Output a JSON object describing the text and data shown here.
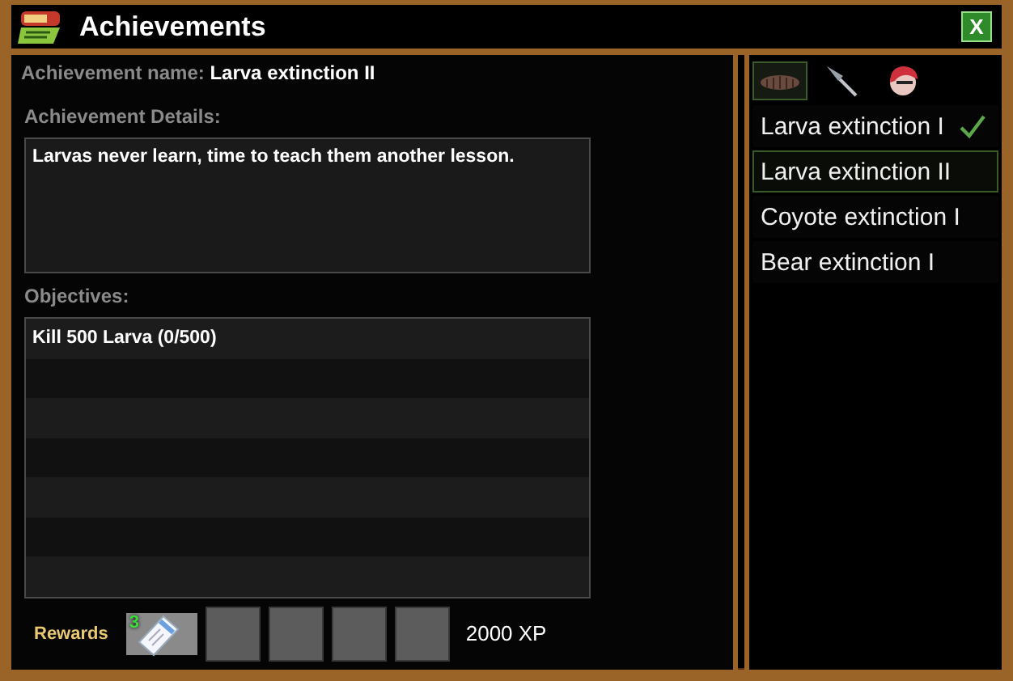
{
  "window": {
    "title": "Achievements",
    "close_label": "X"
  },
  "details": {
    "name_label": "Achievement name:",
    "name": "Larva extinction II",
    "details_label": "Achievement Details:",
    "description": "Larvas never learn, time to teach them another lesson.",
    "objectives_label": "Objectives:",
    "objectives": [
      "Kill 500 Larva (0/500)"
    ]
  },
  "rewards": {
    "label": "Rewards",
    "slots": [
      {
        "kind": "item",
        "count": "3"
      },
      {
        "kind": "empty"
      },
      {
        "kind": "empty"
      },
      {
        "kind": "empty"
      },
      {
        "kind": "empty"
      }
    ],
    "xp": "2000 XP"
  },
  "tabs": [
    {
      "kind": "larva",
      "selected": true
    },
    {
      "kind": "spear",
      "selected": false
    },
    {
      "kind": "character",
      "selected": false
    }
  ],
  "achievements": [
    {
      "label": "Larva extinction I",
      "completed": true,
      "selected": false
    },
    {
      "label": "Larva extinction II",
      "completed": false,
      "selected": true
    },
    {
      "label": "Coyote extinction I",
      "completed": false,
      "selected": false
    },
    {
      "label": "Bear extinction I",
      "completed": false,
      "selected": false
    }
  ]
}
